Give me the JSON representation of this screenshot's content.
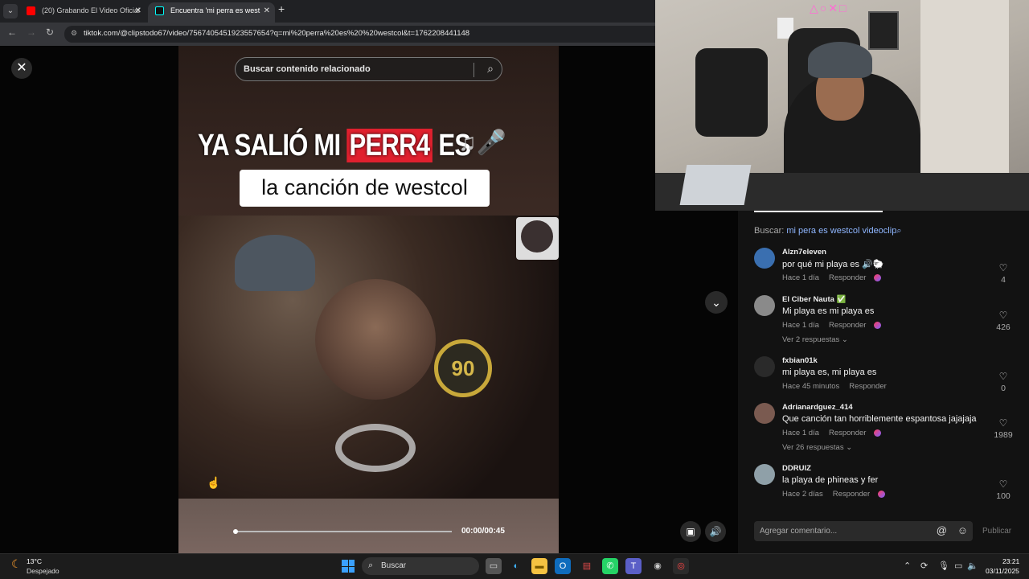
{
  "browser": {
    "tabs": [
      {
        "title": "(20) Grabando El Video Oficial",
        "favicon_color": "#ff0000",
        "close": "✕"
      },
      {
        "title": "Encuentra 'mi perra es west",
        "favicon_color": "#111111",
        "close": "✕"
      }
    ],
    "new_tab": "+",
    "url": "tiktok.com/@clipstodo67/video/7567405451923557654?q=mi%20perra%20es%20%20westcol&t=1762208441148"
  },
  "video": {
    "close_glyph": "✕",
    "search_placeholder": "Buscar contenido relacionado",
    "headline_pre": "YA SALIÓ MI ",
    "headline_red": "PERR4",
    "headline_post": " ES",
    "subheadline": "la canción de westcol",
    "medal_text": "90",
    "time": "00:00/00:45",
    "progress": 0.0
  },
  "comments_panel": {
    "search_label": "Buscar:",
    "search_query": "mi pera es westcol videoclip",
    "comments": [
      {
        "user": "Alzn7eleven",
        "text": "por qué mi playa es 🔊🐑",
        "time": "Hace 1 día",
        "reply": "Responder",
        "likes": "4",
        "avatar_color": "#3a6fb0"
      },
      {
        "user": "El Ciber Nauta ✅",
        "text": "Mi playa es mi playa es",
        "time": "Hace 1 día",
        "reply": "Responder",
        "likes": "426",
        "more": "Ver 2 respuestas ⌄",
        "avatar_color": "#8a8a8a"
      },
      {
        "user": "fxbian01k",
        "text": "mi playa es, mi playa es",
        "time": "Hace 45 minutos",
        "reply": "Responder",
        "likes": "0",
        "avatar_color": "#2a2a2a"
      },
      {
        "user": "Adrianardguez_414",
        "text": "Que canción tan horriblemente espantosa jajajaja",
        "time": "Hace 1 día",
        "reply": "Responder",
        "likes": "1989",
        "more": "Ver 26 respuestas ⌄",
        "avatar_color": "#7a5a50"
      },
      {
        "user": "DDRUIZ",
        "text": "la playa de phineas y fer",
        "time": "Hace 2 días",
        "reply": "Responder",
        "likes": "100",
        "avatar_color": "#8fa0a8"
      }
    ],
    "comment_placeholder": "Agregar comentario...",
    "publish": "Publicar"
  },
  "taskbar": {
    "weather_temp": "13°C",
    "weather_desc": "Despejado",
    "search": "Buscar",
    "time": "23:21",
    "date": "03/11/2025"
  }
}
